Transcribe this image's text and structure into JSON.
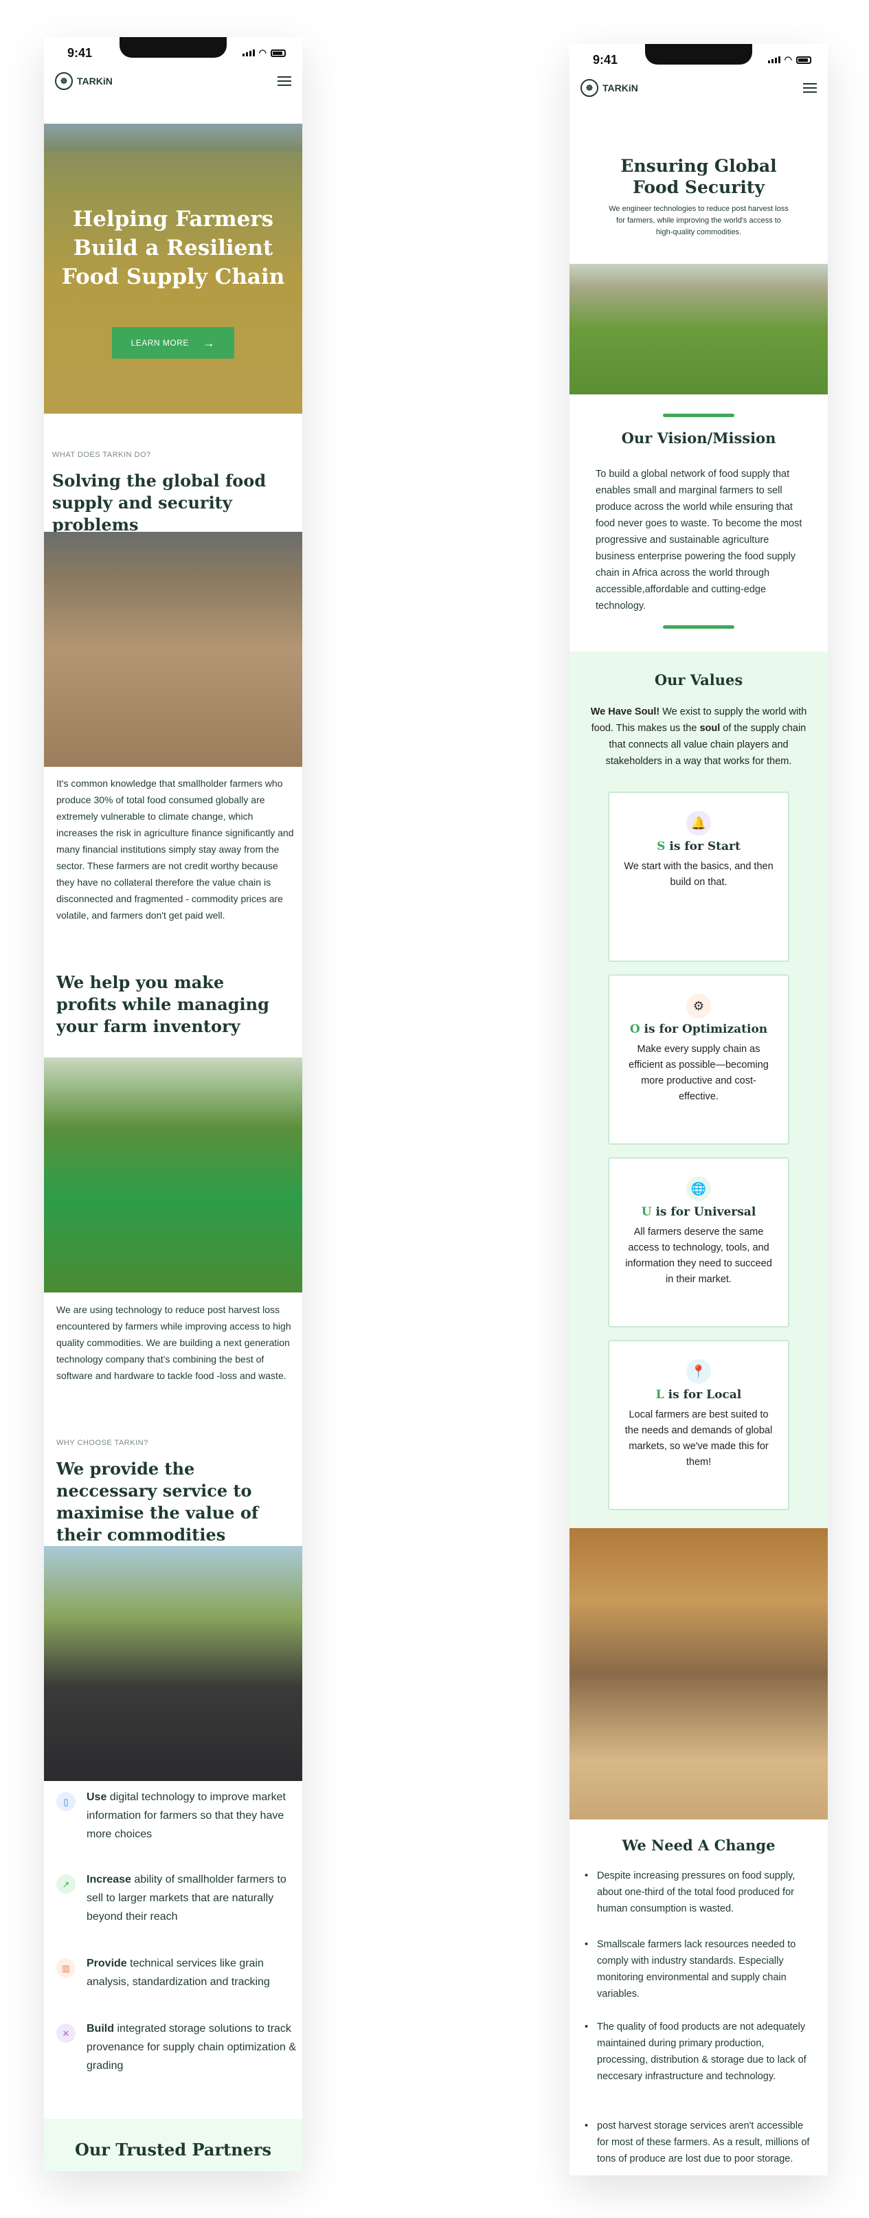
{
  "colors": {
    "primary": "#1f3a2f",
    "accent": "#3ea85a",
    "soft_bg": "#e9faec"
  },
  "status_time": "9:41",
  "brand": "TARKiN",
  "left": {
    "hero_title": "Helping Farmers Build a Resilient Food Supply Chain",
    "hero_button": "LEARN MORE",
    "eyebrow_1": "WHAT DOES TARKIN DO?",
    "heading_1": "Solving the global food supply and security problems",
    "para_1": "It's common knowledge that smallholder farmers who produce 30% of total food consumed globally are extremely vulnerable to climate change, which increases the risk in agriculture finance significantly and many financial institutions simply stay away from the sector. These farmers are not credit worthy because they have no collateral therefore the value chain is disconnected and fragmented - commodity prices are volatile, and farmers don't get paid well.",
    "heading_2": "We help you make profits while managing your farm inventory",
    "para_2": "We are using technology to reduce post harvest loss encountered by farmers while improving access to high quality commodities. We are building a next generation technology company that's combining the best of software and hardware to tackle food -loss and waste.",
    "eyebrow_2": "WHY CHOOSE TARKIN?",
    "heading_3": "We provide the neccessary service to maximise the value of their commodities",
    "bullets": [
      {
        "bold": "Use",
        "text": " digital technology to improve market information for farmers so that they have more choices",
        "icon": "phone-icon"
      },
      {
        "bold": "Increase",
        "text": " ability of smallholder farmers to sell to larger markets that are naturally beyond their reach",
        "icon": "trend-up-icon"
      },
      {
        "bold": "Provide",
        "text": "  technical services like grain analysis, standardization and tracking",
        "icon": "bar-chart-icon"
      },
      {
        "bold": "Build",
        "text": " integrated storage solutions to track provenance for supply chain optimization & grading",
        "icon": "tools-icon"
      }
    ],
    "partners_title": "Our  Trusted Partners"
  },
  "right": {
    "title": "Ensuring Global Food Security",
    "subtitle": "We engineer technologies to reduce post harvest loss for farmers, while improving the world's access to high-quality commodities.",
    "vision_title": "Our Vision/Mission",
    "vision_text": "To build a global network of food supply that enables small and marginal farmers to sell produce across the world while ensuring that food never goes to waste. To become the most progressive and sustainable agriculture business enterprise powering the food supply chain in Africa across the world through accessible,affordable and cutting-edge technology.",
    "values_title": "Our Values",
    "values_intro_bold": "We Have Soul!",
    "values_intro_a": " We exist to supply the  world with food. This makes us the ",
    "values_intro_soul": "soul",
    "values_intro_b": " of the supply chain that connects all value chain players  and stakeholders in a way that works for them.",
    "values": [
      {
        "letter": "S",
        "title": " is for Start",
        "text": "We start with the basics, and then build on that.",
        "icon": "rocket-icon"
      },
      {
        "letter": "O",
        "title": " is for Optimization",
        "text": "Make every supply chain as efficient as possible—becoming more productive and cost-effective.",
        "icon": "gear-icon"
      },
      {
        "letter": "U",
        "title": " is for Universal",
        "text": "All farmers deserve the same access to technology, tools, and information they need to succeed in their market.",
        "icon": "globe-icon"
      },
      {
        "letter": "L",
        "title": " is for Local",
        "text": "Local farmers are best suited to the needs and demands of global markets, so we've made this for them!",
        "icon": "location-icon"
      }
    ],
    "change_title": "We Need A Change",
    "change_items": [
      "Despite increasing pressures on food supply, about one-third of the total food produced for human consumption is wasted.",
      "Smallscale farmers lack resources needed to comply with industry standards. Especially monitoring environmental and supply chain variables.",
      "The quality of food products are not adequately maintained during primary production, processing, distribution & storage due to lack of neccesary infrastructure and technology.",
      "post harvest storage services aren't accessible for most of these farmers. As a result, millions of tons of produce are lost due to poor storage."
    ]
  }
}
